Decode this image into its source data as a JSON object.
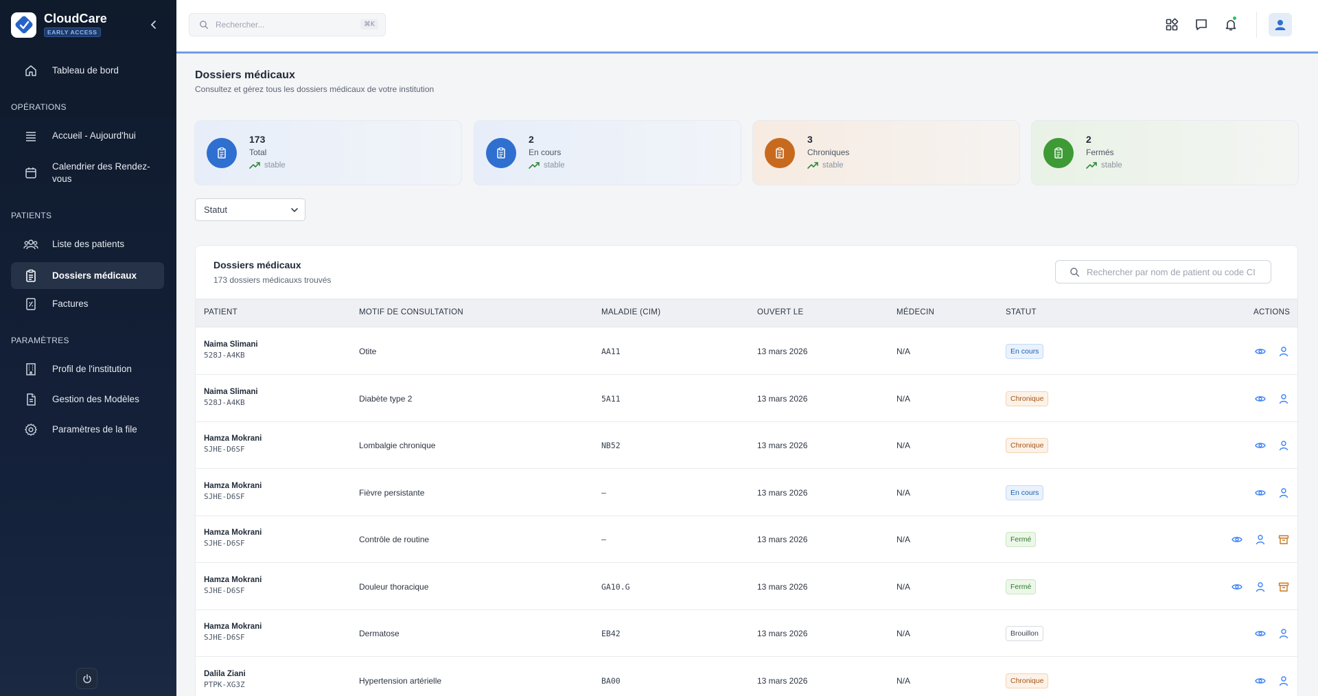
{
  "brand": {
    "name": "CloudCare",
    "badge": "EARLY ACCESS"
  },
  "sidebar": {
    "items_top": [
      {
        "label": "Tableau de bord",
        "icon": "home-icon"
      }
    ],
    "sections": [
      {
        "title": "OPÉRATIONS",
        "items": [
          {
            "label": "Accueil - Aujourd'hui",
            "icon": "list-icon"
          },
          {
            "label": "Calendrier des Rendez-vous",
            "icon": "calendar-icon"
          }
        ]
      },
      {
        "title": "PATIENTS",
        "items": [
          {
            "label": "Liste des patients",
            "icon": "users-icon"
          },
          {
            "label": "Dossiers médicaux",
            "icon": "clipboard-icon",
            "active": true
          },
          {
            "label": "Factures",
            "icon": "invoice-icon"
          }
        ]
      },
      {
        "title": "PARAMÈTRES",
        "items": [
          {
            "label": "Profil de l'institution",
            "icon": "building-icon"
          },
          {
            "label": "Gestion des Modèles",
            "icon": "document-icon"
          },
          {
            "label": "Paramètres de la file",
            "icon": "gear-icon"
          }
        ]
      }
    ]
  },
  "topbar": {
    "search_placeholder": "Rechercher...",
    "search_shortcut": "⌘K"
  },
  "page": {
    "title": "Dossiers médicaux",
    "subtitle": "Consultez et gérez tous les dossiers médicaux de votre institution"
  },
  "stats": [
    {
      "value": "173",
      "label": "Total",
      "trend": "stable",
      "color": "#2f6fd0"
    },
    {
      "value": "2",
      "label": "En cours",
      "trend": "stable",
      "color": "#2f6fd0"
    },
    {
      "value": "3",
      "label": "Chroniques",
      "trend": "stable",
      "color": "#c86a1e"
    },
    {
      "value": "2",
      "label": "Fermés",
      "trend": "stable",
      "color": "#3d9a35"
    }
  ],
  "filter": {
    "status_label": "Statut"
  },
  "table": {
    "title": "Dossiers médicaux",
    "count": "173 dossiers médicauxs trouvés",
    "search_placeholder": "Rechercher par nom de patient ou code CI",
    "columns": [
      "PATIENT",
      "MOTIF DE CONSULTATION",
      "MALADIE (CIM)",
      "OUVERT LE",
      "MÉDECIN",
      "STATUT",
      "ACTIONS"
    ],
    "rows": [
      {
        "name": "Naima Slimani",
        "code": "528J-A4KB",
        "motif": "Otite",
        "cim": "AA11",
        "date": "13 mars 2026",
        "medecin": "N/A",
        "statut": "En cours",
        "kind": "encours",
        "archive": false
      },
      {
        "name": "Naima Slimani",
        "code": "528J-A4KB",
        "motif": "Diabète type 2",
        "cim": "5A11",
        "date": "13 mars 2026",
        "medecin": "N/A",
        "statut": "Chronique",
        "kind": "chronique",
        "archive": false
      },
      {
        "name": "Hamza Mokrani",
        "code": "SJHE-D6SF",
        "motif": "Lombalgie chronique",
        "cim": "NB52",
        "date": "13 mars 2026",
        "medecin": "N/A",
        "statut": "Chronique",
        "kind": "chronique",
        "archive": false
      },
      {
        "name": "Hamza Mokrani",
        "code": "SJHE-D6SF",
        "motif": "Fièvre persistante",
        "cim": "–",
        "date": "13 mars 2026",
        "medecin": "N/A",
        "statut": "En cours",
        "kind": "encours",
        "archive": false
      },
      {
        "name": "Hamza Mokrani",
        "code": "SJHE-D6SF",
        "motif": "Contrôle de routine",
        "cim": "–",
        "date": "13 mars 2026",
        "medecin": "N/A",
        "statut": "Fermé",
        "kind": "ferme",
        "archive": true
      },
      {
        "name": "Hamza Mokrani",
        "code": "SJHE-D6SF",
        "motif": "Douleur thoracique",
        "cim": "GA10.G",
        "date": "13 mars 2026",
        "medecin": "N/A",
        "statut": "Fermé",
        "kind": "ferme",
        "archive": true
      },
      {
        "name": "Hamza Mokrani",
        "code": "SJHE-D6SF",
        "motif": "Dermatose",
        "cim": "EB42",
        "date": "13 mars 2026",
        "medecin": "N/A",
        "statut": "Brouillon",
        "kind": "brouillon",
        "archive": false
      },
      {
        "name": "Dalila Ziani",
        "code": "PTPK-XG3Z",
        "motif": "Hypertension artérielle",
        "cim": "BA00",
        "date": "13 mars 2026",
        "medecin": "N/A",
        "statut": "Chronique",
        "kind": "chronique",
        "archive": false
      }
    ]
  }
}
